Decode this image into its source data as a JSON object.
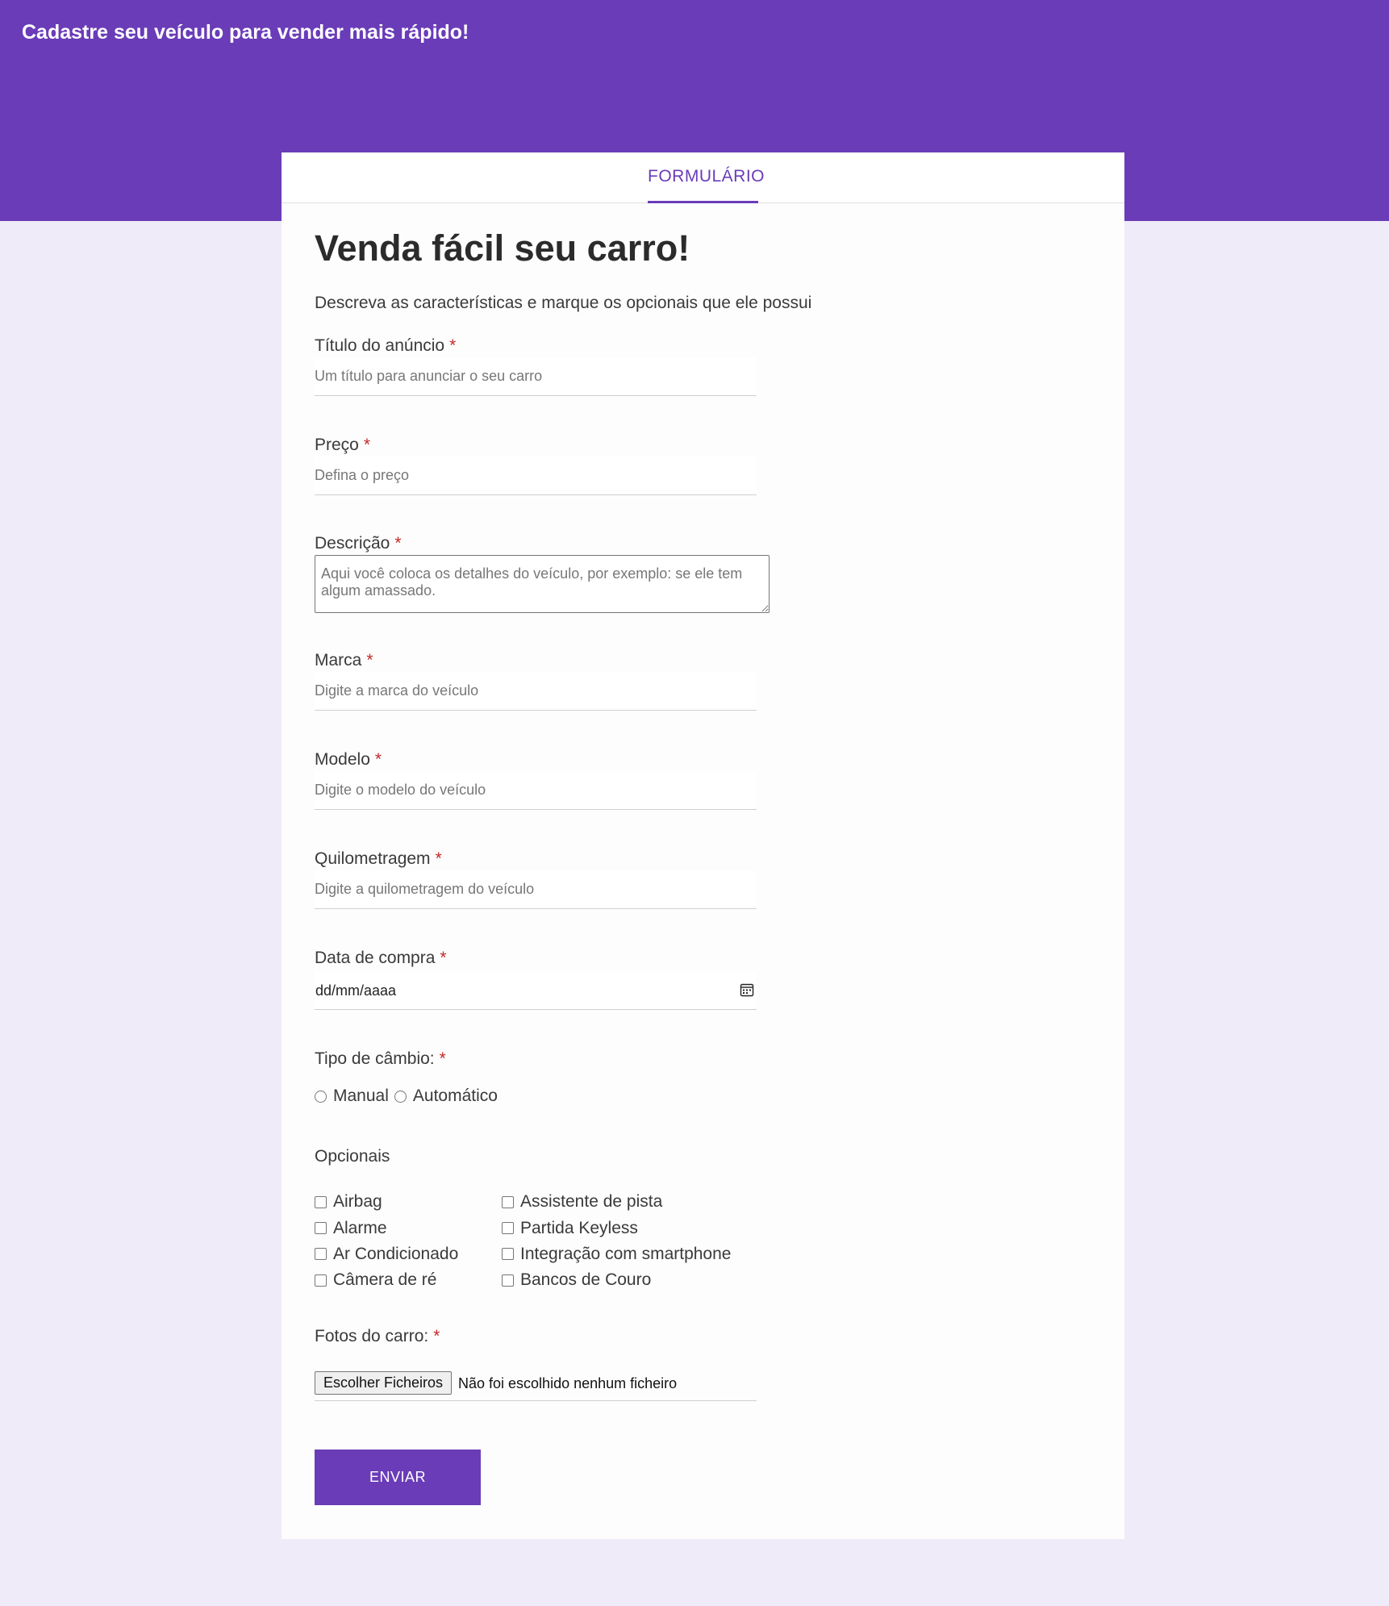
{
  "header": {
    "title": "Cadastre seu veículo para vender mais rápido!"
  },
  "tabs": [
    {
      "label": "FORMULÁRIO",
      "active": true
    }
  ],
  "form": {
    "title": "Venda fácil seu carro!",
    "subtitle": "Descreva as características e marque os opcionais que ele possui",
    "required_marker": "*",
    "fields": {
      "titulo": {
        "label": "Título do anúncio",
        "placeholder": "Um título para anunciar o seu carro"
      },
      "preco": {
        "label": "Preço",
        "placeholder": "Defina o preço"
      },
      "descricao": {
        "label": "Descrição",
        "placeholder": "Aqui você coloca os detalhes do veículo, por exemplo: se ele tem algum amassado."
      },
      "marca": {
        "label": "Marca",
        "placeholder": "Digite a marca do veículo"
      },
      "modelo": {
        "label": "Modelo",
        "placeholder": "Digite o modelo do veículo"
      },
      "quilometragem": {
        "label": "Quilometragem",
        "placeholder": "Digite a quilometragem do veículo"
      },
      "data_compra": {
        "label": "Data de compra",
        "value": "dd/mm/aaaa"
      }
    },
    "cambio": {
      "label": "Tipo de câmbio:",
      "options": [
        "Manual",
        "Automático"
      ]
    },
    "opcionais": {
      "label": "Opcionais",
      "column1": [
        "Airbag",
        "Alarme",
        "Ar Condicionado",
        "Câmera de ré"
      ],
      "column2": [
        "Assistente de pista",
        "Partida Keyless",
        "Integração com smartphone",
        "Bancos de Couro"
      ]
    },
    "fotos": {
      "label": "Fotos do carro:",
      "button_label": "Escolher Ficheiros",
      "status": "Não foi escolhido nenhum ficheiro"
    },
    "submit_label": "ENVIAR"
  },
  "colors": {
    "primary": "#6a3cb8",
    "background": "#efebf8",
    "required": "#c62828"
  }
}
